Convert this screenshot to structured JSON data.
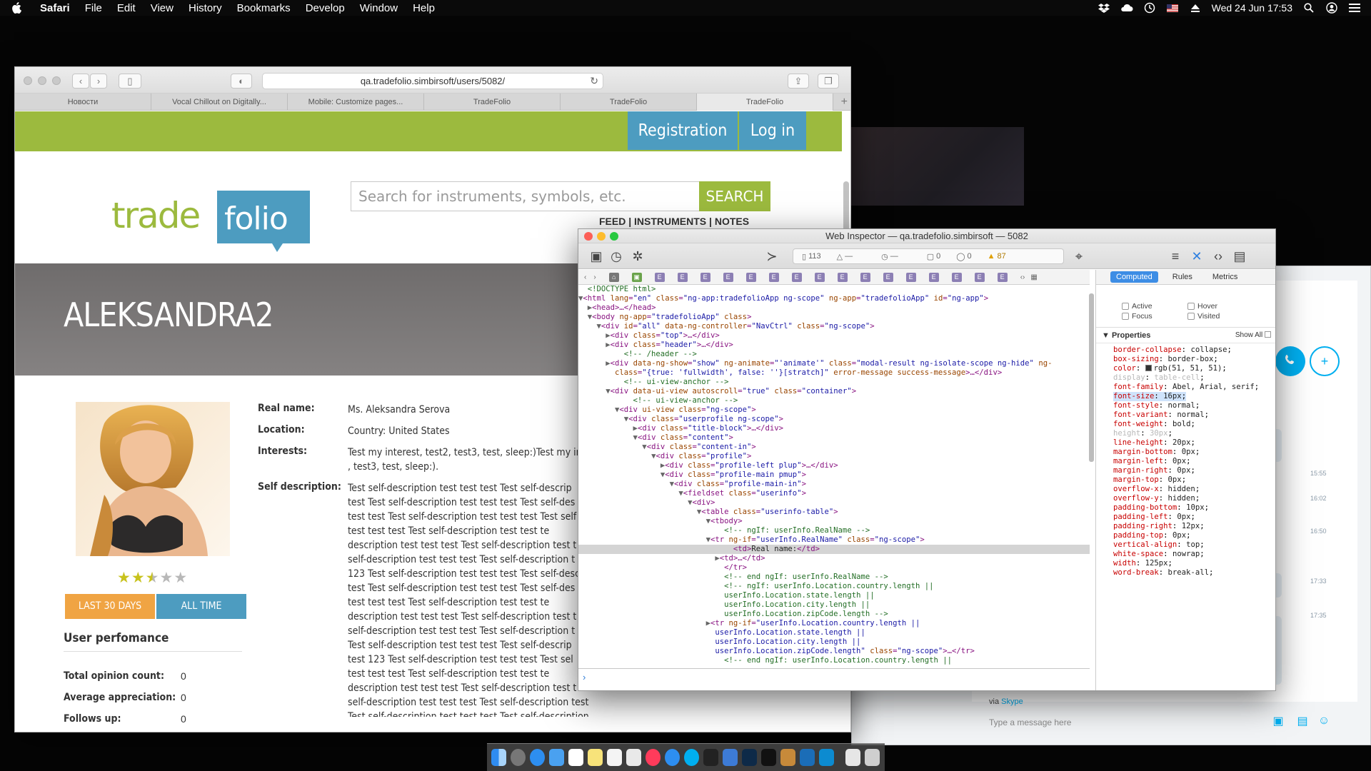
{
  "menubar": {
    "app": "Safari",
    "items": [
      "File",
      "Edit",
      "View",
      "History",
      "Bookmarks",
      "Develop",
      "Window",
      "Help"
    ],
    "clock": "Wed 24 Jun  17:53"
  },
  "safari": {
    "url": "qa.tradefolio.simbirsoft/users/5082/",
    "tabs": [
      "Новости",
      "Vocal Chillout on Digitally...",
      "Mobile: Customize pages...",
      "TradeFolio",
      "TradeFolio",
      "TradeFolio"
    ],
    "active_tab": 5
  },
  "site": {
    "nav": {
      "registration": "Registration",
      "login": "Log in"
    },
    "logo": {
      "left": "trade",
      "right": "folio"
    },
    "search": {
      "placeholder": "Search for instruments, symbols, etc.",
      "button": "SEARCH"
    },
    "subnav": "FEED  |  INSTRUMENTS  |  NOTES",
    "username": "ALEKSANDRA2",
    "rating": {
      "value": 2.5,
      "max": 5
    },
    "periods": {
      "last30": "LAST 30 DAYS",
      "all": "ALL TIME"
    },
    "performance": {
      "heading": "User perfomance",
      "stats": [
        {
          "label": "Total opinion count:",
          "value": "0"
        },
        {
          "label": "Average appreciation:",
          "value": "0"
        },
        {
          "label": "Follows up:",
          "value": "0"
        }
      ]
    },
    "info": {
      "real_name_label": "Real name:",
      "real_name": "Ms. Aleksandra Serova",
      "location_label": "Location:",
      "location": "Country: United States",
      "interests_label": "Interests:",
      "interests_line1": "Test my interest, test2, test3, test, sleep:)Test my in",
      "interests_line2": ", test3, test, sleep:).",
      "self_label": "Self description:",
      "self_lines": [
        "Test self-description test test test Test self-descrip",
        "test Test self-description test test test Test self-des",
        "test test Test self-description test test test Test self",
        "test  test  test  Test  self-description  test  test  te",
        "description test test test Test self-description test t",
        "self-description test test test Test self-description t",
        "123 Test self-description test test test Test self-desc",
        "test Test self-description test test test Test self-des",
        "test  test  test  Test  self-description  test  test  te",
        "description test test test Test self-description test t",
        "self-description test test test Test self-description t",
        "Test self-description test test test Test self-descrip",
        "test 123 Test self-description test test test Test sel",
        "test  test  test  Test  self-description  test  test  te",
        "description test test test Test self-description test t",
        "self-description test test test Test self-description test test test",
        "Test self-description test test test Test self-description test test test"
      ]
    }
  },
  "inspector": {
    "title": "Web Inspector — qa.tradefolio.simbirsoft — 5082",
    "activity": {
      "resources": "113",
      "a": "—",
      "b": "—",
      "logs": "0",
      "errors": "0",
      "warnings": "87"
    },
    "sidebar_tabs": [
      "Computed",
      "Rules",
      "Metrics"
    ],
    "states": [
      "Active",
      "Hover",
      "Focus",
      "Visited"
    ],
    "properties_heading": "Properties",
    "show_all": "Show All",
    "console_prompt": "›",
    "properties": [
      {
        "name": "border-collapse",
        "value": "collapse"
      },
      {
        "name": "box-sizing",
        "value": "border-box"
      },
      {
        "name": "color",
        "value": "rgb(51, 51, 51)",
        "swatch": "#333333"
      },
      {
        "name": "display",
        "value": "table-cell",
        "inherited": true
      },
      {
        "name": "font-family",
        "value": "Abel, Arial, serif"
      },
      {
        "name": "font-size",
        "value": "16px",
        "highlight": true
      },
      {
        "name": "font-style",
        "value": "normal"
      },
      {
        "name": "font-variant",
        "value": "normal"
      },
      {
        "name": "font-weight",
        "value": "bold"
      },
      {
        "name": "height",
        "value": "30px",
        "inherited": true
      },
      {
        "name": "line-height",
        "value": "20px"
      },
      {
        "name": "margin-bottom",
        "value": "0px"
      },
      {
        "name": "margin-left",
        "value": "0px"
      },
      {
        "name": "margin-right",
        "value": "0px"
      },
      {
        "name": "margin-top",
        "value": "0px"
      },
      {
        "name": "overflow-x",
        "value": "hidden"
      },
      {
        "name": "overflow-y",
        "value": "hidden"
      },
      {
        "name": "padding-bottom",
        "value": "10px"
      },
      {
        "name": "padding-left",
        "value": "0px"
      },
      {
        "name": "padding-right",
        "value": "12px"
      },
      {
        "name": "padding-top",
        "value": "0px"
      },
      {
        "name": "vertical-align",
        "value": "top"
      },
      {
        "name": "white-space",
        "value": "nowrap"
      },
      {
        "name": "width",
        "value": "125px"
      },
      {
        "name": "word-break",
        "value": "break-all"
      }
    ],
    "dom_lines": [
      {
        "i": 0,
        "h": "<span class=\"cm\">&lt;!DOCTYPE html&gt;</span>"
      },
      {
        "i": 0,
        "t": "▼",
        "h": "&lt;html <span class=\"an\">lang</span>=<span class=\"av\">\"en\"</span> <span class=\"an\">class</span>=<span class=\"av\">\"ng-app:tradefolioApp ng-scope\"</span> <span class=\"an\">ng-app</span>=<span class=\"av\">\"tradefolioApp\"</span> <span class=\"an\">id</span>=<span class=\"av\">\"ng-app\"</span>&gt;"
      },
      {
        "i": 1,
        "t": "▶",
        "h": "&lt;head&gt;…&lt;/head&gt;"
      },
      {
        "i": 1,
        "t": "▼",
        "h": "&lt;body <span class=\"an\">ng-app</span>=<span class=\"av\">\"tradefolioApp\"</span> <span class=\"an\">class</span>&gt;"
      },
      {
        "i": 2,
        "t": "▼",
        "h": "&lt;div <span class=\"an\">id</span>=<span class=\"av\">\"all\"</span> <span class=\"an\">data-ng-controller</span>=<span class=\"av\">\"NavCtrl\"</span> <span class=\"an\">class</span>=<span class=\"av\">\"ng-scope\"</span>&gt;"
      },
      {
        "i": 3,
        "t": "▶",
        "h": "&lt;div <span class=\"an\">class</span>=<span class=\"av\">\"top\"</span>&gt;…&lt;/div&gt;"
      },
      {
        "i": 3,
        "t": "▶",
        "h": "&lt;div <span class=\"an\">class</span>=<span class=\"av\">\"header\"</span>&gt;…&lt;/div&gt;"
      },
      {
        "i": 4,
        "h": "<span class=\"cm\">&lt;!-- /header --&gt;</span>"
      },
      {
        "i": 3,
        "t": "▶",
        "h": "&lt;div <span class=\"an\">data-ng-show</span>=<span class=\"av\">\"show\"</span> <span class=\"an\">ng-animate</span>=<span class=\"av\">\"'animate'\"</span> <span class=\"an\">class</span>=<span class=\"av\">\"modal-result ng-isolate-scope ng-hide\"</span> <span class=\"an\">ng-</span>"
      },
      {
        "i": 3,
        "h": "<span class=\"an\">class</span>=<span class=\"av\">\"{true: 'fullwidth', false: ''}[stratch]\"</span> <span class=\"an\">error-message success-message</span>&gt;…&lt;/div&gt;"
      },
      {
        "i": 4,
        "h": "<span class=\"cm\">&lt;!-- ui-view-anchor --&gt;</span>"
      },
      {
        "i": 3,
        "t": "▼",
        "h": "&lt;div <span class=\"an\">data-ui-view</span> <span class=\"an\">autoscroll</span>=<span class=\"av\">\"true\"</span> <span class=\"an\">class</span>=<span class=\"av\">\"container\"</span>&gt;"
      },
      {
        "i": 5,
        "h": "<span class=\"cm\">&lt;!-- ui-view-anchor --&gt;</span>"
      },
      {
        "i": 4,
        "t": "▼",
        "h": "&lt;div <span class=\"an\">ui-view</span> <span class=\"an\">class</span>=<span class=\"av\">\"ng-scope\"</span>&gt;"
      },
      {
        "i": 5,
        "t": "▼",
        "h": "&lt;div <span class=\"an\">class</span>=<span class=\"av\">\"userprofile ng-scope\"</span>&gt;"
      },
      {
        "i": 6,
        "t": "▶",
        "h": "&lt;div <span class=\"an\">class</span>=<span class=\"av\">\"title-block\"</span>&gt;…&lt;/div&gt;"
      },
      {
        "i": 6,
        "t": "▼",
        "h": "&lt;div <span class=\"an\">class</span>=<span class=\"av\">\"content\"</span>&gt;"
      },
      {
        "i": 7,
        "t": "▼",
        "h": "&lt;div <span class=\"an\">class</span>=<span class=\"av\">\"content-in\"</span>&gt;"
      },
      {
        "i": 8,
        "t": "▼",
        "h": "&lt;div <span class=\"an\">class</span>=<span class=\"av\">\"profile\"</span>&gt;"
      },
      {
        "i": 9,
        "t": "▶",
        "h": "&lt;div <span class=\"an\">class</span>=<span class=\"av\">\"profile-left plup\"</span>&gt;…&lt;/div&gt;"
      },
      {
        "i": 9,
        "t": "▼",
        "h": "&lt;div <span class=\"an\">class</span>=<span class=\"av\">\"profile-main pmup\"</span>&gt;"
      },
      {
        "i": 10,
        "t": "▼",
        "h": "&lt;div <span class=\"an\">class</span>=<span class=\"av\">\"profile-main-in\"</span>&gt;"
      },
      {
        "i": 11,
        "t": "▼",
        "h": "&lt;fieldset <span class=\"an\">class</span>=<span class=\"av\">\"userinfo\"</span>&gt;"
      },
      {
        "i": 12,
        "t": "▼",
        "h": "&lt;div&gt;"
      },
      {
        "i": 13,
        "t": "▼",
        "h": "&lt;table <span class=\"an\">class</span>=<span class=\"av\">\"userinfo-table\"</span>&gt;"
      },
      {
        "i": 14,
        "t": "▼",
        "h": "&lt;tbody&gt;"
      },
      {
        "i": 15,
        "h": "<span class=\"cm\">&lt;!-- ngIf: userInfo.RealName --&gt;</span>"
      },
      {
        "i": 14,
        "t": "▼",
        "h": "&lt;tr <span class=\"an\">ng-if</span>=<span class=\"av\">\"userInfo.RealName\"</span> <span class=\"an\">class</span>=<span class=\"av\">\"ng-scope\"</span>&gt;"
      },
      {
        "i": 16,
        "sel": true,
        "h": "&lt;td&gt;<span class=\"tx\">Real name:</span>&lt;/td&gt;"
      },
      {
        "i": 15,
        "t": "▶",
        "h": "&lt;td&gt;…&lt;/td&gt;"
      },
      {
        "i": 15,
        "h": "&lt;/tr&gt;"
      },
      {
        "i": 15,
        "h": "<span class=\"cm\">&lt;!-- end ngIf: userInfo.RealName --&gt;</span>"
      },
      {
        "i": 15,
        "h": "<span class=\"cm\">&lt;!-- ngIf: userInfo.Location.country.length ||</span>"
      },
      {
        "i": 15,
        "h": "<span class=\"cm\">userInfo.Location.state.length ||</span>"
      },
      {
        "i": 15,
        "h": "<span class=\"cm\">userInfo.Location.city.length ||</span>"
      },
      {
        "i": 15,
        "h": "<span class=\"cm\">userInfo.Location.zipCode.length --&gt;</span>"
      },
      {
        "i": 14,
        "t": "▶",
        "h": "&lt;tr <span class=\"an\">ng-if</span>=<span class=\"av\">\"userInfo.Location.country.length ||</span>"
      },
      {
        "i": 14,
        "h": "<span class=\"av\">userInfo.Location.state.length ||</span>"
      },
      {
        "i": 14,
        "h": "<span class=\"av\">userInfo.Location.city.length ||</span>"
      },
      {
        "i": 14,
        "h": "<span class=\"av\">userInfo.Location.zipCode.length\"</span> <span class=\"an\">class</span>=<span class=\"av\">\"ng-scope\"</span>&gt;…&lt;/tr&gt;"
      },
      {
        "i": 15,
        "h": "<span class=\"cm\">&lt;!-- end ngIf: userInfo.Location.country.length ||</span>"
      }
    ]
  },
  "skype": {
    "via_label": "via",
    "via_brand": "Skype",
    "message_placeholder": "Type a message here",
    "times": [
      "15:55",
      "16:02",
      "16:50",
      "17:33",
      "17:35"
    ]
  }
}
